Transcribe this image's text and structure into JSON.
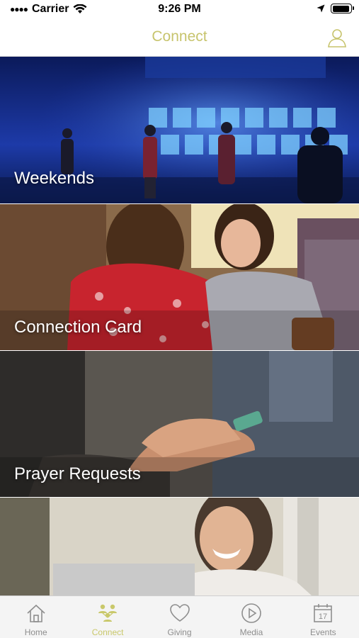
{
  "status_bar": {
    "carrier": "Carrier",
    "time": "9:26 PM",
    "battery_level": 0.95
  },
  "nav": {
    "title": "Connect",
    "profile_icon": "person-outline-icon"
  },
  "tiles": [
    {
      "label": "Weekends",
      "image": "worship-band-on-stage-photo"
    },
    {
      "label": "Connection Card",
      "image": "people-hugging-photo"
    },
    {
      "label": "Prayer Requests",
      "image": "stacked-hands-photo"
    },
    {
      "label": "",
      "image": "smiling-woman-at-laptop-photo"
    }
  ],
  "tab_bar": {
    "active": "Connect",
    "tabs": [
      {
        "label": "Home",
        "icon": "house-icon"
      },
      {
        "label": "Connect",
        "icon": "people-group-icon"
      },
      {
        "label": "Giving",
        "icon": "heart-icon"
      },
      {
        "label": "Media",
        "icon": "play-circle-icon"
      },
      {
        "label": "Events",
        "icon": "calendar-icon",
        "badge_number": "17"
      }
    ]
  },
  "colors": {
    "accent": "#c9c86a",
    "tab_inactive": "#8e8e8e",
    "nav_title": "#c7c46d"
  }
}
